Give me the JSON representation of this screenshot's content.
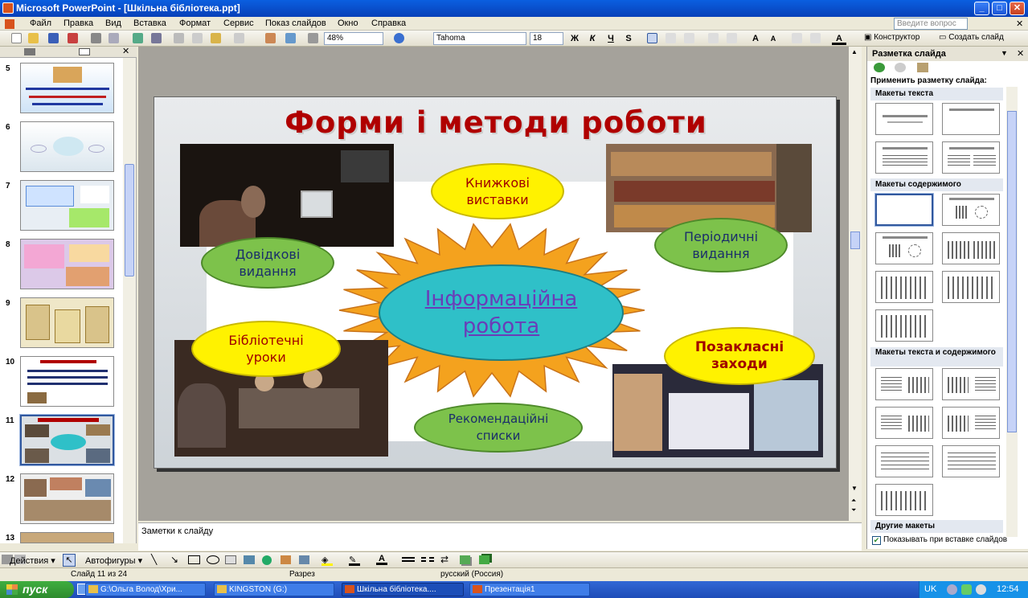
{
  "window": {
    "title": "Microsoft PowerPoint - [Шкільна бібліотека.ppt]"
  },
  "menu": {
    "items": [
      "Файл",
      "Правка",
      "Вид",
      "Вставка",
      "Формат",
      "Сервис",
      "Показ слайдов",
      "Окно",
      "Справка"
    ],
    "ask_placeholder": "Введите вопрос"
  },
  "toolbar": {
    "zoom": "48%",
    "font": "Tahoma",
    "font_size": "18",
    "bold": "Ж",
    "italic": "К",
    "underline": "Ч",
    "shadow": "S",
    "designer": "Конструктор",
    "new_slide": "Создать слайд"
  },
  "thumbnails": [
    {
      "num": "5"
    },
    {
      "num": "6"
    },
    {
      "num": "7"
    },
    {
      "num": "8"
    },
    {
      "num": "9"
    },
    {
      "num": "10"
    },
    {
      "num": "11"
    },
    {
      "num": "12"
    },
    {
      "num": "13"
    }
  ],
  "slide": {
    "title": "Форми і методи роботи",
    "center": "Інформаційна\nробота",
    "ellipses": {
      "books": "Книжкові\nвиставки",
      "reference": "Довідкові\nвидання",
      "periodicals": "Періодичні\nвидання",
      "lessons": "Бібліотечні\nуроки",
      "extracurricular": "Позакласні\nзаходи",
      "lists": "Рекомендаційні\nсписки"
    }
  },
  "notes": {
    "placeholder": "Заметки к слайду"
  },
  "taskpane": {
    "title": "Разметка слайда",
    "apply": "Применить разметку слайда:",
    "sections": [
      "Макеты текста",
      "Макеты содержимого",
      "Макеты текста и содержимого",
      "Другие макеты"
    ],
    "show_on_insert": "Показывать при вставке слайдов"
  },
  "drawbar": {
    "actions": "Действия",
    "autoshapes": "Автофигуры"
  },
  "status": {
    "slide": "Слайд 11 из 24",
    "design": "Разрез",
    "language": "русский (Россия)"
  },
  "taskbar": {
    "start": "пуск",
    "tasks": [
      "G:\\Ольга Волод\\Хри...",
      "KINGSTON (G:)",
      "Шкільна бібліотека....",
      "Презентація1"
    ],
    "lang": "UK",
    "time": "12:54"
  },
  "colors": {
    "title_red": "#B00000",
    "ellipse_yellow": "#FFF200",
    "ellipse_green": "#7DC24B",
    "center_cyan": "#2FC0C8",
    "sun_orange": "#F4A21E"
  }
}
